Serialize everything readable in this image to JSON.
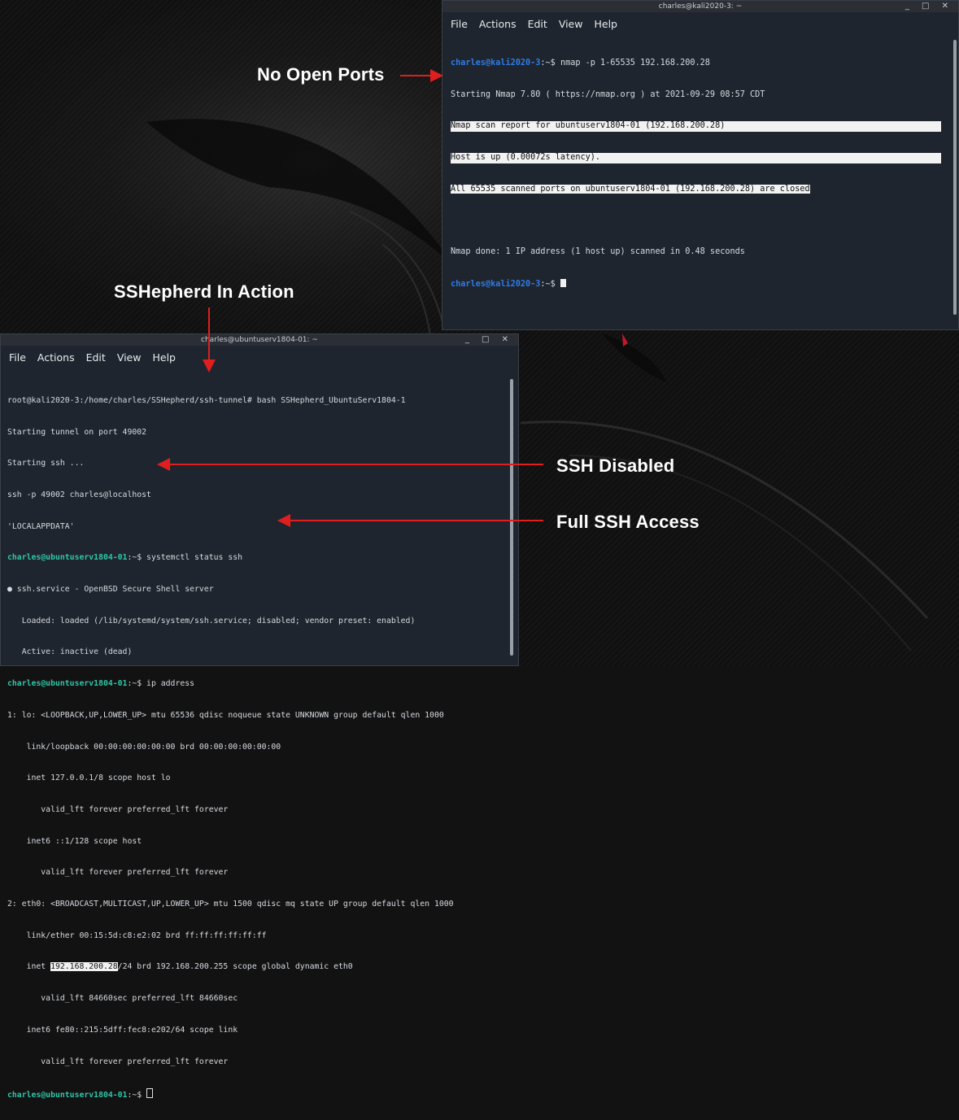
{
  "annotations": {
    "no_open_ports": "No Open Ports",
    "sshepherd_in_action": "SSHepherd In Action",
    "ssh_disabled": "SSH Disabled",
    "full_ssh_access": "Full SSH Access"
  },
  "arrow_color": "#e01e1e",
  "top_terminal": {
    "title": "charles@kali2020-3: ~",
    "controls": "_ □ ✕",
    "menu": [
      "File",
      "Actions",
      "Edit",
      "View",
      "Help"
    ],
    "lines": {
      "l1_prompt": "charles@kali2020-3",
      "l1_rest": ":~$ nmap -p 1-65535 192.168.200.28",
      "l2": "Starting Nmap 7.80 ( https://nmap.org ) at 2021-09-29 08:57 CDT",
      "l3": "Nmap scan report for ubuntuserv1804-01 (192.168.200.28)",
      "l4": "Host is up (0.00072s latency).",
      "l5": "All 65535 scanned ports on ubuntuserv1804-01 (192.168.200.28) are closed",
      "l7": "Nmap done: 1 IP address (1 host up) scanned in 0.48 seconds",
      "l8_prompt": "charles@kali2020-3",
      "l8_rest": ":~$ "
    }
  },
  "bottom_terminal": {
    "title": "charles@ubuntuserv1804-01: ~",
    "controls": "_ □ ✕",
    "menu": [
      "File",
      "Actions",
      "Edit",
      "View",
      "Help"
    ],
    "lines": {
      "b1": "root@kali2020-3:/home/charles/SSHepherd/ssh-tunnel# bash SSHepherd_UbuntuServ1804-1",
      "b2": "Starting tunnel on port 49002",
      "b3": "Starting ssh ...",
      "b4": "ssh -p 49002 charles@localhost",
      "b5": "'LOCALAPPDATA'",
      "b6_prompt": "charles@ubuntuserv1804-01",
      "b6_rest": ":~$ systemctl status ssh",
      "b7": "● ssh.service - OpenBSD Secure Shell server",
      "b8": "   Loaded: loaded (/lib/systemd/system/ssh.service; disabled; vendor preset: enabled)",
      "b9": "   Active: inactive (dead)",
      "b10_prompt": "charles@ubuntuserv1804-01",
      "b10_rest": ":~$ ip address",
      "b11": "1: lo: <LOOPBACK,UP,LOWER_UP> mtu 65536 qdisc noqueue state UNKNOWN group default qlen 1000",
      "b12": "    link/loopback 00:00:00:00:00:00 brd 00:00:00:00:00:00",
      "b13": "    inet 127.0.0.1/8 scope host lo",
      "b14": "       valid_lft forever preferred_lft forever",
      "b15": "    inet6 ::1/128 scope host",
      "b16": "       valid_lft forever preferred_lft forever",
      "b17": "2: eth0: <BROADCAST,MULTICAST,UP,LOWER_UP> mtu 1500 qdisc mq state UP group default qlen 1000",
      "b18": "    link/ether 00:15:5d:c8:e2:02 brd ff:ff:ff:ff:ff:ff",
      "b19_pre": "    inet ",
      "b19_ip": "192.168.200.28",
      "b19_post": "/24 brd 192.168.200.255 scope global dynamic eth0",
      "b20": "       valid_lft 84660sec preferred_lft 84660sec",
      "b21": "    inet6 fe80::215:5dff:fec8:e202/64 scope link",
      "b22": "       valid_lft forever preferred_lft forever",
      "b23_prompt": "charles@ubuntuserv1804-01",
      "b23_rest": ":~$ "
    }
  }
}
